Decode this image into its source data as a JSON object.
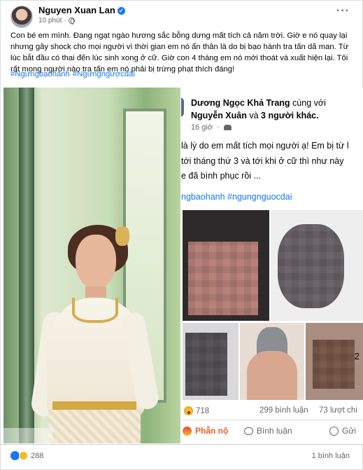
{
  "post": {
    "author": "Nguyen Xuan Lan",
    "time": "10 phút",
    "text_lines": [
      "Con bé em mình. Đang ngạt ngào hương sắc bỗng dưng mất tích cả năm trời. Giờ e nó quay lại",
      "nhưng gây shock cho mọi người vì thời gian em nó ẩn thân là do bị bạo hành tra tấn dã man. Từ",
      "lúc bắt đầu có thai đến lúc sinh xong ở cữ. Giờ con 4 tháng em nó mới thoát và xuất hiện lại. Tôi",
      "rất mong người nào tra tấn em nó phải bị trừng phạt thích đáng!"
    ],
    "hashtags": [
      "#Ngưngbạohành",
      "#Ngưngngượcđãi"
    ]
  },
  "shared": {
    "author": "Dương Ngọc Khả Trang",
    "with_text": "cùng với",
    "tagged": "Nguyễn Xuân",
    "conj": "và",
    "others": "3 người khác.",
    "time": "16 giờ",
    "body_lines": [
      "là lý do em mất tích mọi người ạ! Em bị từ l",
      "tới tháng thứ 3 và tới khi ở cữ thì như này",
      "e đã bình phục rồi ..."
    ],
    "hashtags": "ngbaohanh #ngungnguocdai",
    "reaction_count": "718",
    "comments": "299 bình luận",
    "shares": "73 lượt chi",
    "actions": {
      "react": "Phẫn nộ",
      "comment": "Bình luận",
      "share": "Gửi"
    },
    "gallery_badge": "2"
  },
  "footer": {
    "reaction_count": "288",
    "comments": "1 bình luận"
  },
  "colors": {
    "link": "#1877f2",
    "angry": "#e4602a",
    "muted": "#65676b"
  },
  "icons": [
    "verified-icon",
    "globe-icon",
    "more-icon",
    "people-icon",
    "wow-icon",
    "angry-icon",
    "comment-icon",
    "share-icon",
    "like-icon",
    "sad-icon"
  ]
}
